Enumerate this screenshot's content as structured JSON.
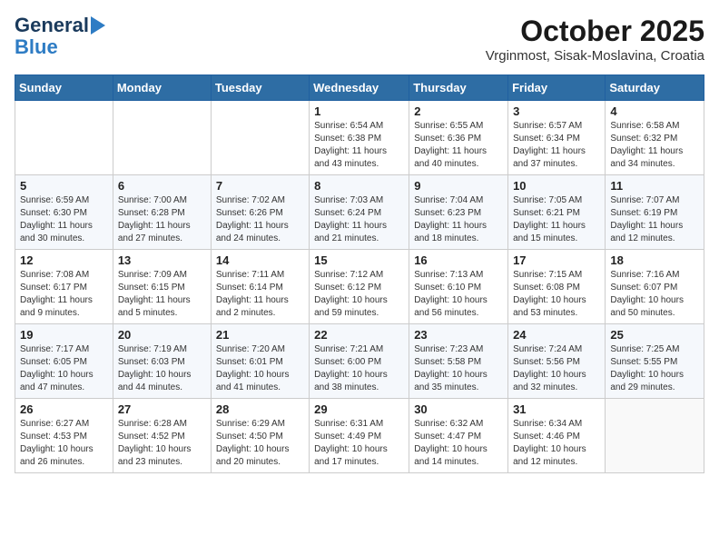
{
  "logo": {
    "line1": "General",
    "line2": "Blue"
  },
  "title": "October 2025",
  "subtitle": "Vrginmost, Sisak-Moslavina, Croatia",
  "days_of_week": [
    "Sunday",
    "Monday",
    "Tuesday",
    "Wednesday",
    "Thursday",
    "Friday",
    "Saturday"
  ],
  "weeks": [
    [
      {
        "day": "",
        "info": ""
      },
      {
        "day": "",
        "info": ""
      },
      {
        "day": "",
        "info": ""
      },
      {
        "day": "1",
        "info": "Sunrise: 6:54 AM\nSunset: 6:38 PM\nDaylight: 11 hours\nand 43 minutes."
      },
      {
        "day": "2",
        "info": "Sunrise: 6:55 AM\nSunset: 6:36 PM\nDaylight: 11 hours\nand 40 minutes."
      },
      {
        "day": "3",
        "info": "Sunrise: 6:57 AM\nSunset: 6:34 PM\nDaylight: 11 hours\nand 37 minutes."
      },
      {
        "day": "4",
        "info": "Sunrise: 6:58 AM\nSunset: 6:32 PM\nDaylight: 11 hours\nand 34 minutes."
      }
    ],
    [
      {
        "day": "5",
        "info": "Sunrise: 6:59 AM\nSunset: 6:30 PM\nDaylight: 11 hours\nand 30 minutes."
      },
      {
        "day": "6",
        "info": "Sunrise: 7:00 AM\nSunset: 6:28 PM\nDaylight: 11 hours\nand 27 minutes."
      },
      {
        "day": "7",
        "info": "Sunrise: 7:02 AM\nSunset: 6:26 PM\nDaylight: 11 hours\nand 24 minutes."
      },
      {
        "day": "8",
        "info": "Sunrise: 7:03 AM\nSunset: 6:24 PM\nDaylight: 11 hours\nand 21 minutes."
      },
      {
        "day": "9",
        "info": "Sunrise: 7:04 AM\nSunset: 6:23 PM\nDaylight: 11 hours\nand 18 minutes."
      },
      {
        "day": "10",
        "info": "Sunrise: 7:05 AM\nSunset: 6:21 PM\nDaylight: 11 hours\nand 15 minutes."
      },
      {
        "day": "11",
        "info": "Sunrise: 7:07 AM\nSunset: 6:19 PM\nDaylight: 11 hours\nand 12 minutes."
      }
    ],
    [
      {
        "day": "12",
        "info": "Sunrise: 7:08 AM\nSunset: 6:17 PM\nDaylight: 11 hours\nand 9 minutes."
      },
      {
        "day": "13",
        "info": "Sunrise: 7:09 AM\nSunset: 6:15 PM\nDaylight: 11 hours\nand 5 minutes."
      },
      {
        "day": "14",
        "info": "Sunrise: 7:11 AM\nSunset: 6:14 PM\nDaylight: 11 hours\nand 2 minutes."
      },
      {
        "day": "15",
        "info": "Sunrise: 7:12 AM\nSunset: 6:12 PM\nDaylight: 10 hours\nand 59 minutes."
      },
      {
        "day": "16",
        "info": "Sunrise: 7:13 AM\nSunset: 6:10 PM\nDaylight: 10 hours\nand 56 minutes."
      },
      {
        "day": "17",
        "info": "Sunrise: 7:15 AM\nSunset: 6:08 PM\nDaylight: 10 hours\nand 53 minutes."
      },
      {
        "day": "18",
        "info": "Sunrise: 7:16 AM\nSunset: 6:07 PM\nDaylight: 10 hours\nand 50 minutes."
      }
    ],
    [
      {
        "day": "19",
        "info": "Sunrise: 7:17 AM\nSunset: 6:05 PM\nDaylight: 10 hours\nand 47 minutes."
      },
      {
        "day": "20",
        "info": "Sunrise: 7:19 AM\nSunset: 6:03 PM\nDaylight: 10 hours\nand 44 minutes."
      },
      {
        "day": "21",
        "info": "Sunrise: 7:20 AM\nSunset: 6:01 PM\nDaylight: 10 hours\nand 41 minutes."
      },
      {
        "day": "22",
        "info": "Sunrise: 7:21 AM\nSunset: 6:00 PM\nDaylight: 10 hours\nand 38 minutes."
      },
      {
        "day": "23",
        "info": "Sunrise: 7:23 AM\nSunset: 5:58 PM\nDaylight: 10 hours\nand 35 minutes."
      },
      {
        "day": "24",
        "info": "Sunrise: 7:24 AM\nSunset: 5:56 PM\nDaylight: 10 hours\nand 32 minutes."
      },
      {
        "day": "25",
        "info": "Sunrise: 7:25 AM\nSunset: 5:55 PM\nDaylight: 10 hours\nand 29 minutes."
      }
    ],
    [
      {
        "day": "26",
        "info": "Sunrise: 6:27 AM\nSunset: 4:53 PM\nDaylight: 10 hours\nand 26 minutes."
      },
      {
        "day": "27",
        "info": "Sunrise: 6:28 AM\nSunset: 4:52 PM\nDaylight: 10 hours\nand 23 minutes."
      },
      {
        "day": "28",
        "info": "Sunrise: 6:29 AM\nSunset: 4:50 PM\nDaylight: 10 hours\nand 20 minutes."
      },
      {
        "day": "29",
        "info": "Sunrise: 6:31 AM\nSunset: 4:49 PM\nDaylight: 10 hours\nand 17 minutes."
      },
      {
        "day": "30",
        "info": "Sunrise: 6:32 AM\nSunset: 4:47 PM\nDaylight: 10 hours\nand 14 minutes."
      },
      {
        "day": "31",
        "info": "Sunrise: 6:34 AM\nSunset: 4:46 PM\nDaylight: 10 hours\nand 12 minutes."
      },
      {
        "day": "",
        "info": ""
      }
    ]
  ]
}
